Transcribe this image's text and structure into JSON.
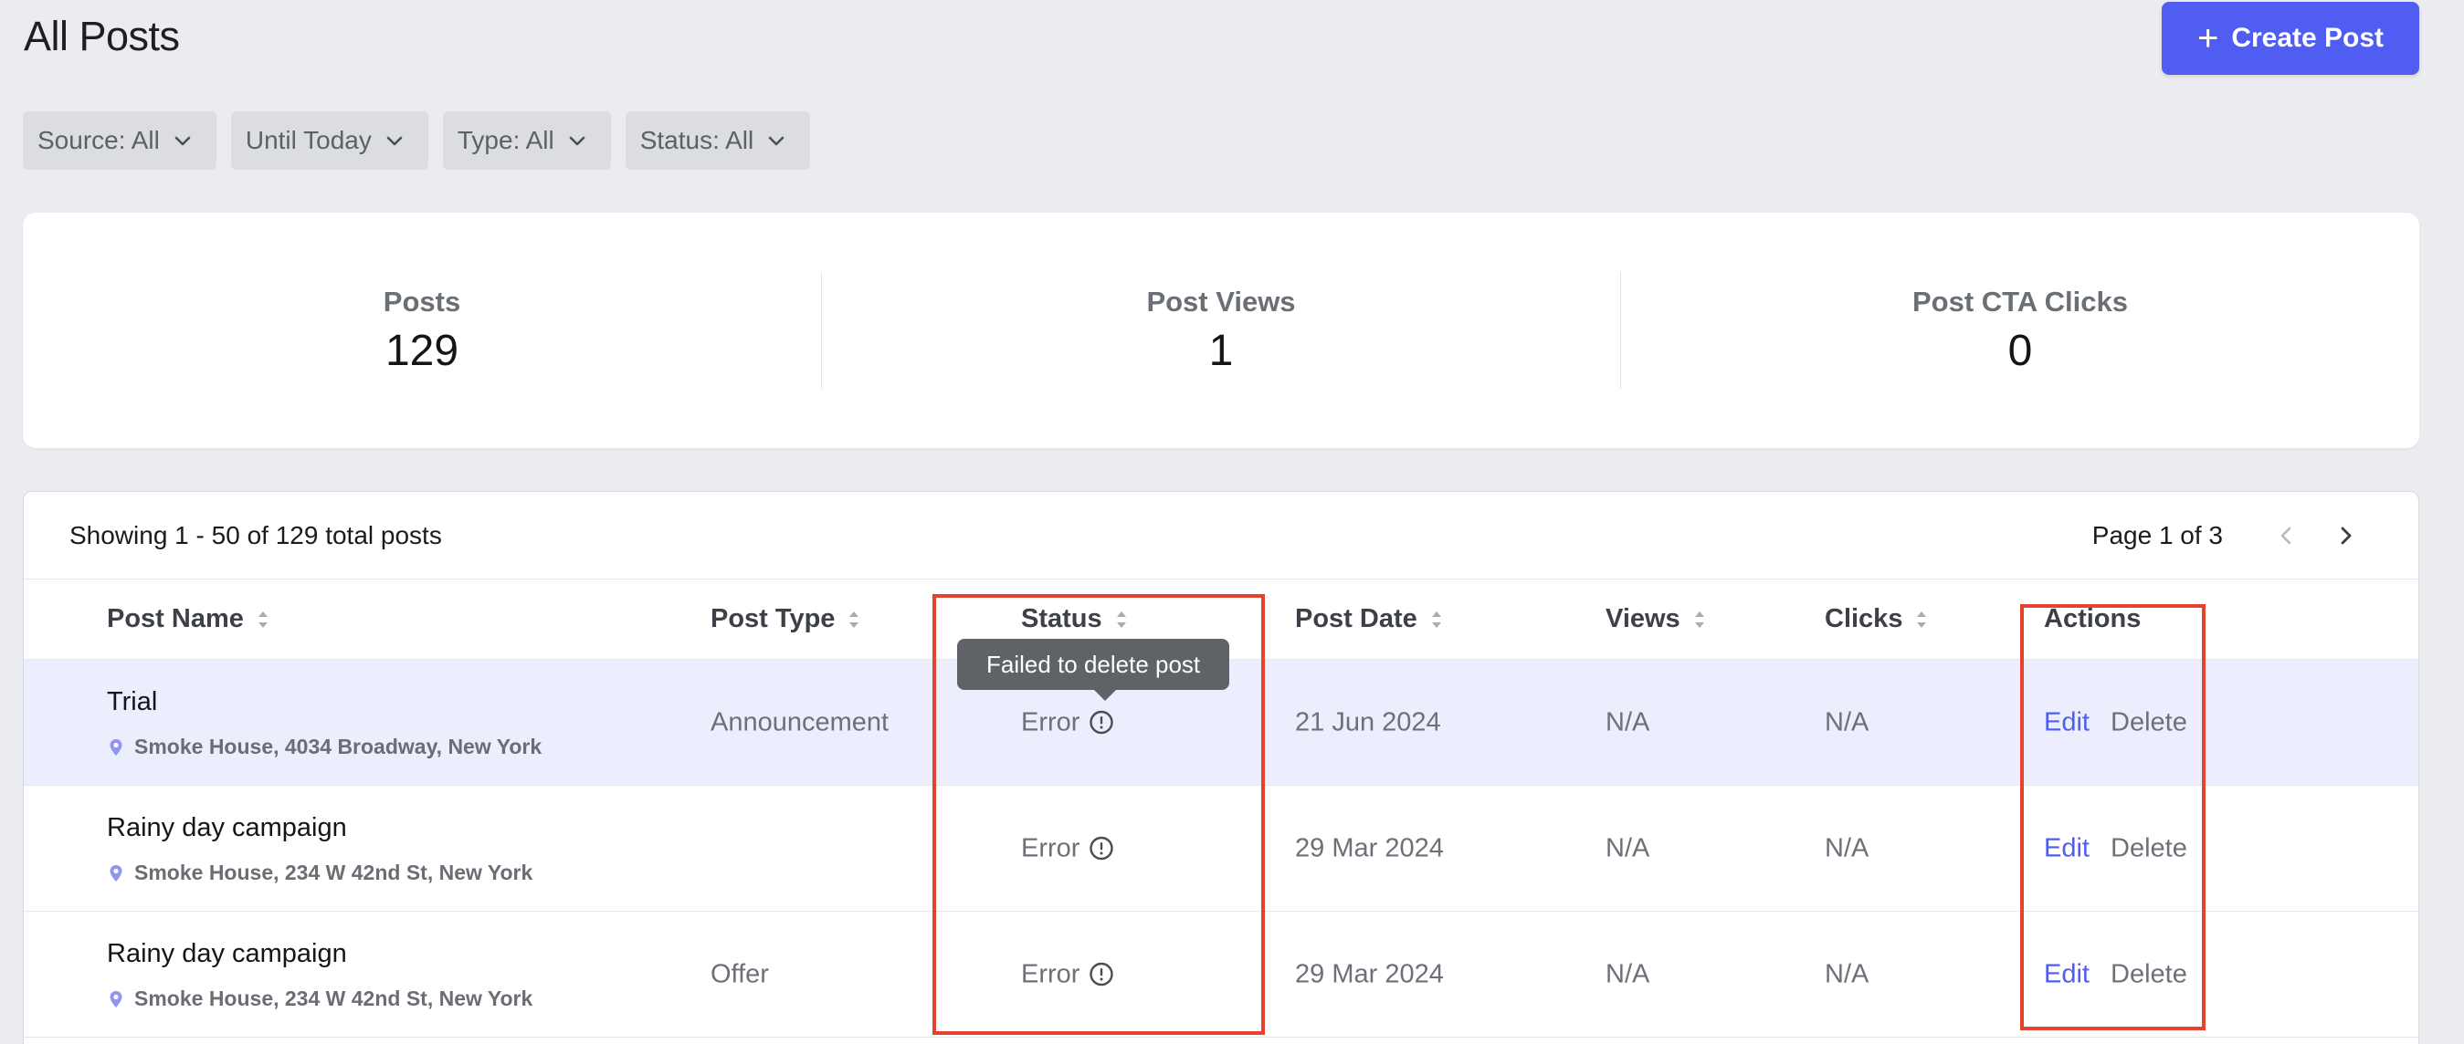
{
  "header": {
    "title": "All Posts",
    "create_button": {
      "icon": "plus-icon",
      "label": "Create Post"
    }
  },
  "filters": [
    {
      "label": "Source: All"
    },
    {
      "label": "Until Today"
    },
    {
      "label": "Type: All"
    },
    {
      "label": "Status: All"
    }
  ],
  "stats": [
    {
      "label": "Posts",
      "value": "129"
    },
    {
      "label": "Post Views",
      "value": "1"
    },
    {
      "label": "Post CTA Clicks",
      "value": "0"
    }
  ],
  "table": {
    "showing_text": "Showing 1 - 50 of 129 total posts",
    "page_info": "Page 1 of 3",
    "columns": {
      "post_name": "Post Name",
      "post_type": "Post Type",
      "status": "Status",
      "post_date": "Post Date",
      "views": "Views",
      "clicks": "Clicks",
      "actions": "Actions"
    },
    "tooltip": "Failed to delete post",
    "rows": [
      {
        "name": "Trial",
        "location": "Smoke House, 4034 Broadway, New York",
        "type": "Announcement",
        "status": "Error",
        "date": "21 Jun 2024",
        "views": "N/A",
        "clicks": "N/A",
        "edit": "Edit",
        "delete": "Delete",
        "highlighted": true
      },
      {
        "name": "Rainy day campaign",
        "location": "Smoke House, 234 W 42nd St, New York",
        "type": "",
        "status": "Error",
        "date": "29 Mar 2024",
        "views": "N/A",
        "clicks": "N/A",
        "edit": "Edit",
        "delete": "Delete",
        "highlighted": false
      },
      {
        "name": "Rainy day campaign",
        "location": "Smoke House, 234 W 42nd St, New York",
        "type": "Offer",
        "status": "Error",
        "date": "29 Mar 2024",
        "views": "N/A",
        "clicks": "N/A",
        "edit": "Edit",
        "delete": "Delete",
        "highlighted": false
      }
    ]
  },
  "colors": {
    "accent": "#4f5df2",
    "annotation": "#e5432f",
    "highlight_row": "#eceefd",
    "page_bg": "#ebecef"
  }
}
